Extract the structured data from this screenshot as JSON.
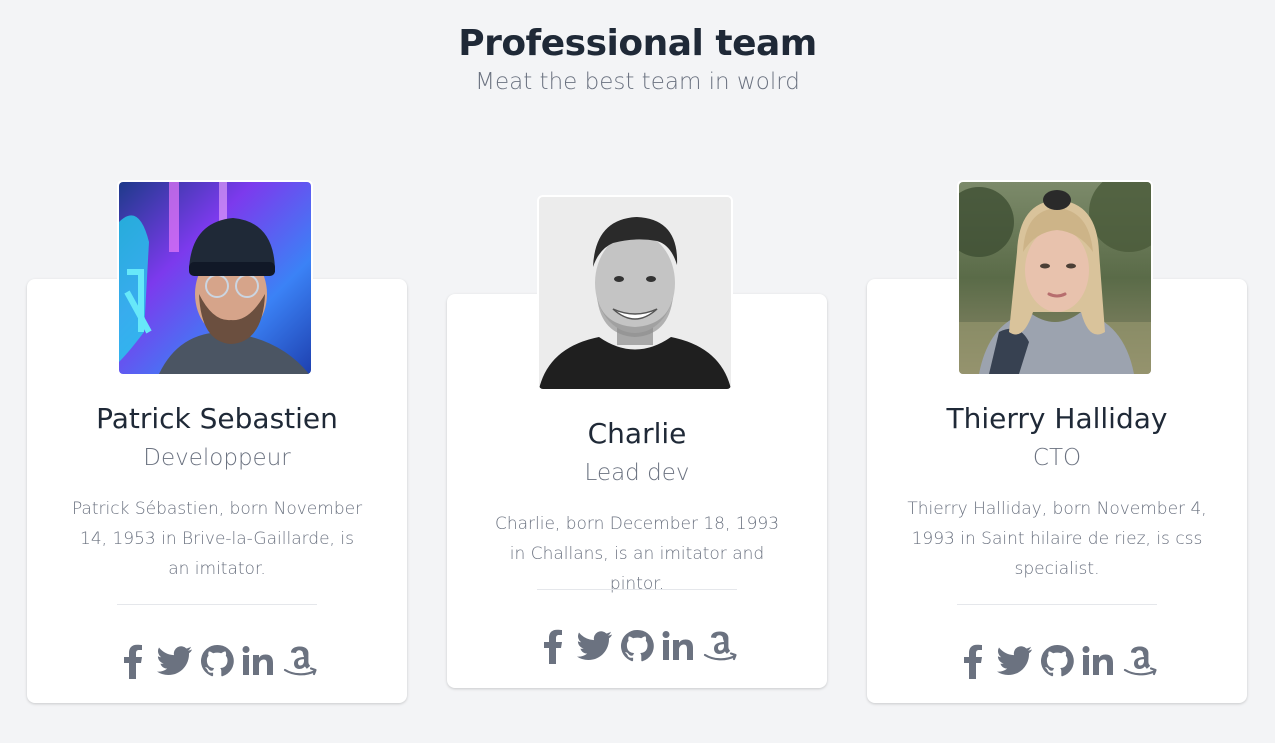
{
  "header": {
    "title": "Professional team",
    "subtitle": "Meat the best team in wolrd"
  },
  "colors": {
    "background": "#f3f4f6",
    "card": "#ffffff",
    "text_dark": "#1f2937",
    "text_muted": "#6b7280",
    "icon": "#6b7280"
  },
  "members": [
    {
      "name": "Patrick Sebastien",
      "role": "Developpeur",
      "bio": "Patrick Sébastien, born November 14, 1953 in Brive-la-Gaillarde, is an imitator.",
      "photo": "bearded-man-neon-photo"
    },
    {
      "name": "Charlie",
      "role": "Lead dev",
      "bio": "Charlie, born December 18, 1993 in Challans, is an imitator and pintor.",
      "photo": "smiling-man-bw-photo"
    },
    {
      "name": "Thierry Halliday",
      "role": "CTO",
      "bio": "Thierry Halliday, born November 4, 1993 in Saint hilaire de riez, is css specialist.",
      "photo": "blonde-woman-outdoor-photo"
    }
  ],
  "social_icons": [
    "facebook-icon",
    "twitter-icon",
    "github-icon",
    "linkedin-icon",
    "amazon-icon"
  ]
}
